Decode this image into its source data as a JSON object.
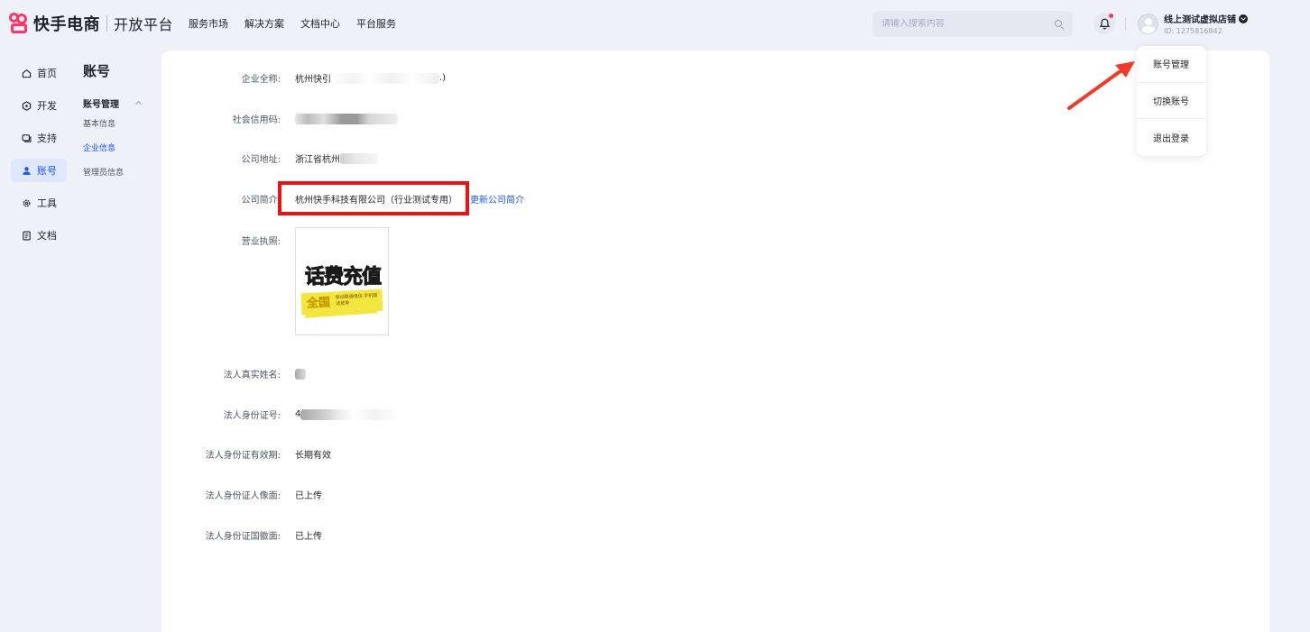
{
  "header": {
    "brand": "快手电商",
    "brand_sub": "开放平台",
    "nav": [
      "服务市场",
      "解决方案",
      "文档中心",
      "平台服务"
    ],
    "search_placeholder": "请输入搜索内容",
    "user_name": "线上测试虚拟店铺",
    "user_id": "ID: 1275816842"
  },
  "dropdown": [
    "账号管理",
    "切换账号",
    "退出登录"
  ],
  "sidebar": {
    "items": [
      {
        "label": "首页",
        "icon": "home-icon"
      },
      {
        "label": "开发",
        "icon": "code-icon"
      },
      {
        "label": "支持",
        "icon": "support-icon"
      },
      {
        "label": "账号",
        "icon": "user-icon"
      },
      {
        "label": "工具",
        "icon": "gear-icon"
      },
      {
        "label": "文档",
        "icon": "document-icon"
      }
    ],
    "active": "账号"
  },
  "submenu": {
    "title": "账号",
    "group": "账号管理",
    "items": [
      "基本信息",
      "企业信息",
      "管理员信息"
    ],
    "active": "企业信息"
  },
  "content": {
    "company_name_label": "企业全称:",
    "company_name_value": "杭州快引",
    "company_name_suffix": ".)",
    "credit_code_label": "社会信用码:",
    "address_label": "公司地址:",
    "address_value": "浙江省杭州",
    "intro_label": "公司简介:",
    "intro_value": "杭州快手科技有限公司（行业测试专用）",
    "intro_link": "更新公司简介",
    "license_label": "营业执照:",
    "license_title": "话费充值",
    "license_band": "全国",
    "license_small": "移动联通电信 手机固话宽带",
    "legal_name_label": "法人真实姓名:",
    "legal_id_label": "法人身份证号:",
    "legal_id_prefix": "4",
    "legal_id_validity_label": "法人身份证有效期:",
    "legal_id_validity_value": "长期有效",
    "id_front_label": "法人身份证人像面:",
    "id_front_value": "已上传",
    "id_back_label": "法人身份证国徽面:",
    "id_back_value": "已上传"
  },
  "colors": {
    "brand": "#fe3666",
    "accent": "#1a56f0",
    "highlight_box": "#f01010",
    "arrow": "#f03a2a"
  }
}
